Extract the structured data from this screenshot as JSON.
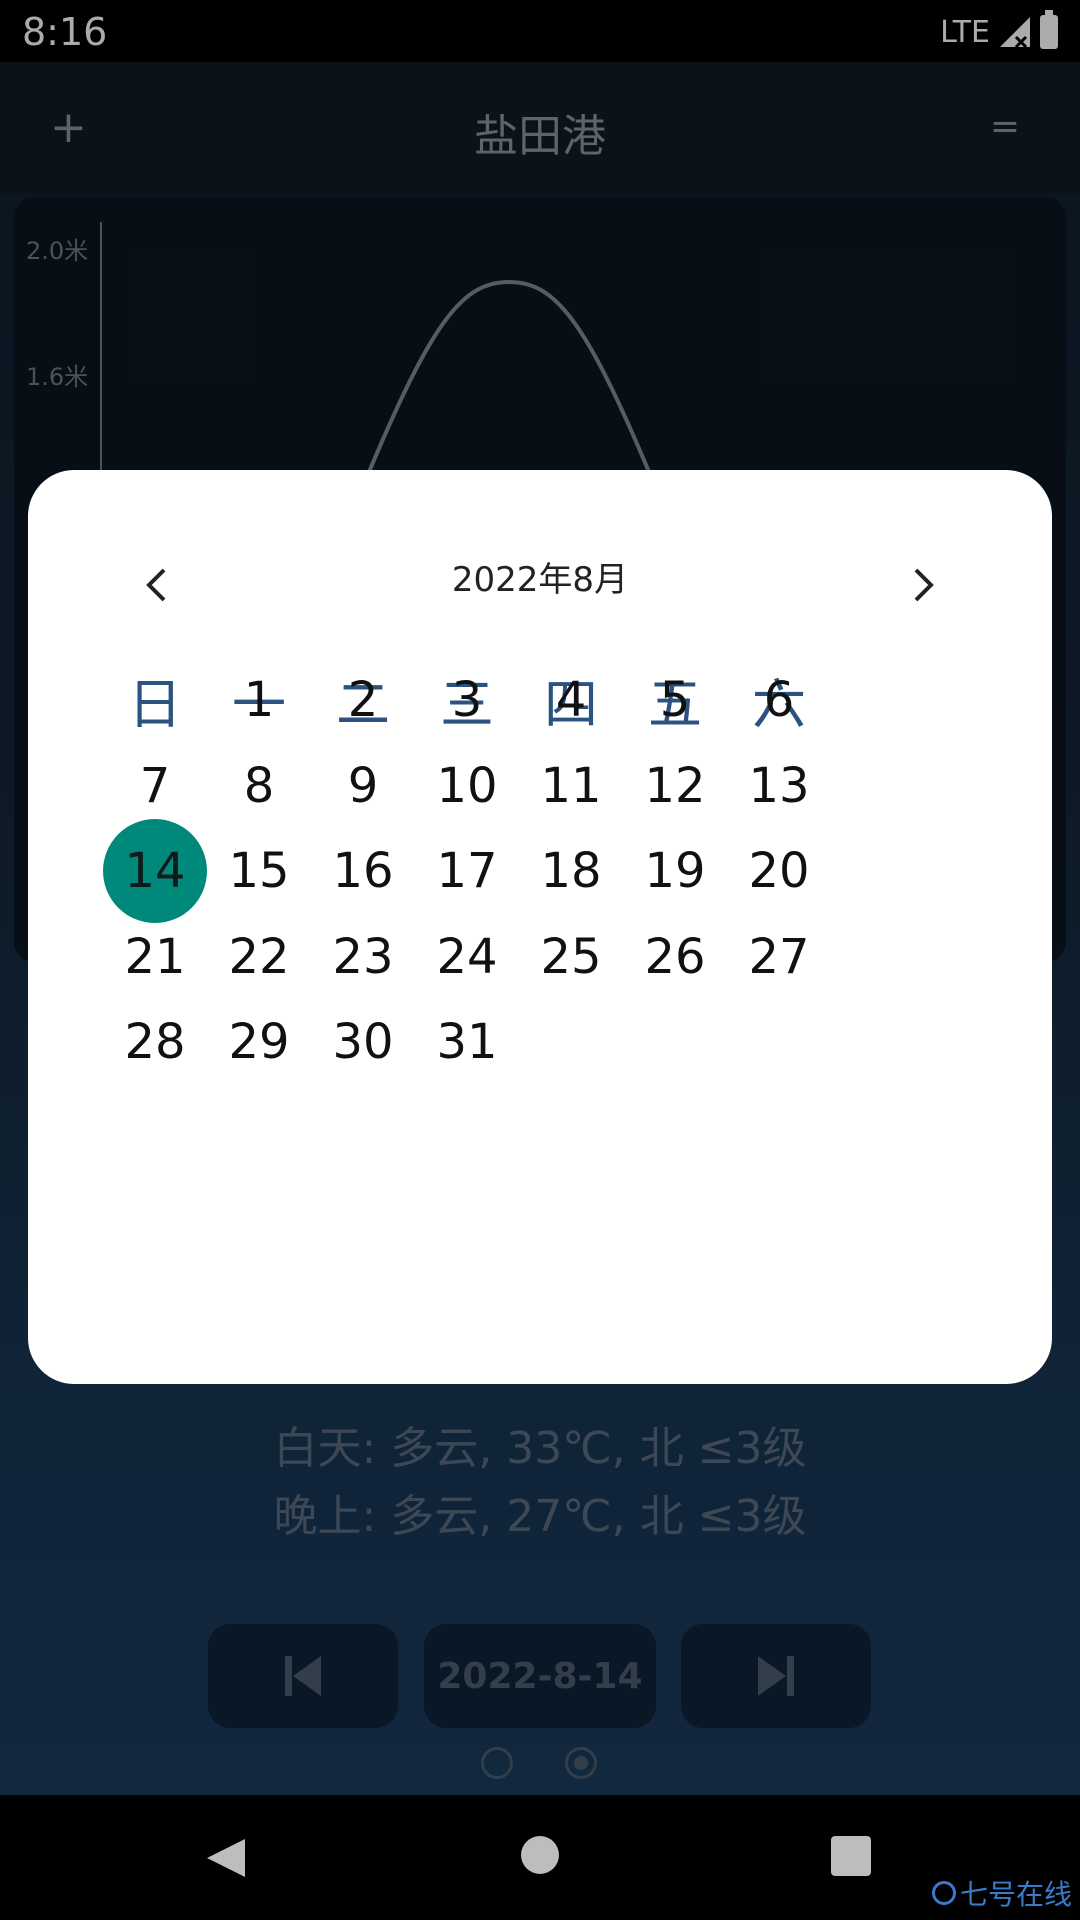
{
  "status_bar": {
    "time": "8:16",
    "network": "LTE"
  },
  "header": {
    "add_label": "+",
    "title": "盐田港",
    "menu_label": "="
  },
  "chart": {
    "y_ticks": [
      "2.0米",
      "1.6米"
    ]
  },
  "weather": {
    "day": "白天: 多云, 33℃, 北 ≤3级",
    "night": "晚上: 多云, 27℃, 北 ≤3级"
  },
  "date_nav": {
    "current_date": "2022-8-14"
  },
  "pager": {
    "pages": 2,
    "active": 2
  },
  "calendar": {
    "title": "2022年8月",
    "weekdays": [
      "日",
      "一",
      "二",
      "三",
      "四",
      "五",
      "六"
    ],
    "first_weekday_index": 1,
    "days_in_month": 31,
    "selected_day": 14,
    "selected_color": "#00897b"
  },
  "watermark": "七号在线",
  "colors": {
    "accent": "#00897b",
    "weekday": "#2b5380",
    "app_bg": "#142638"
  }
}
